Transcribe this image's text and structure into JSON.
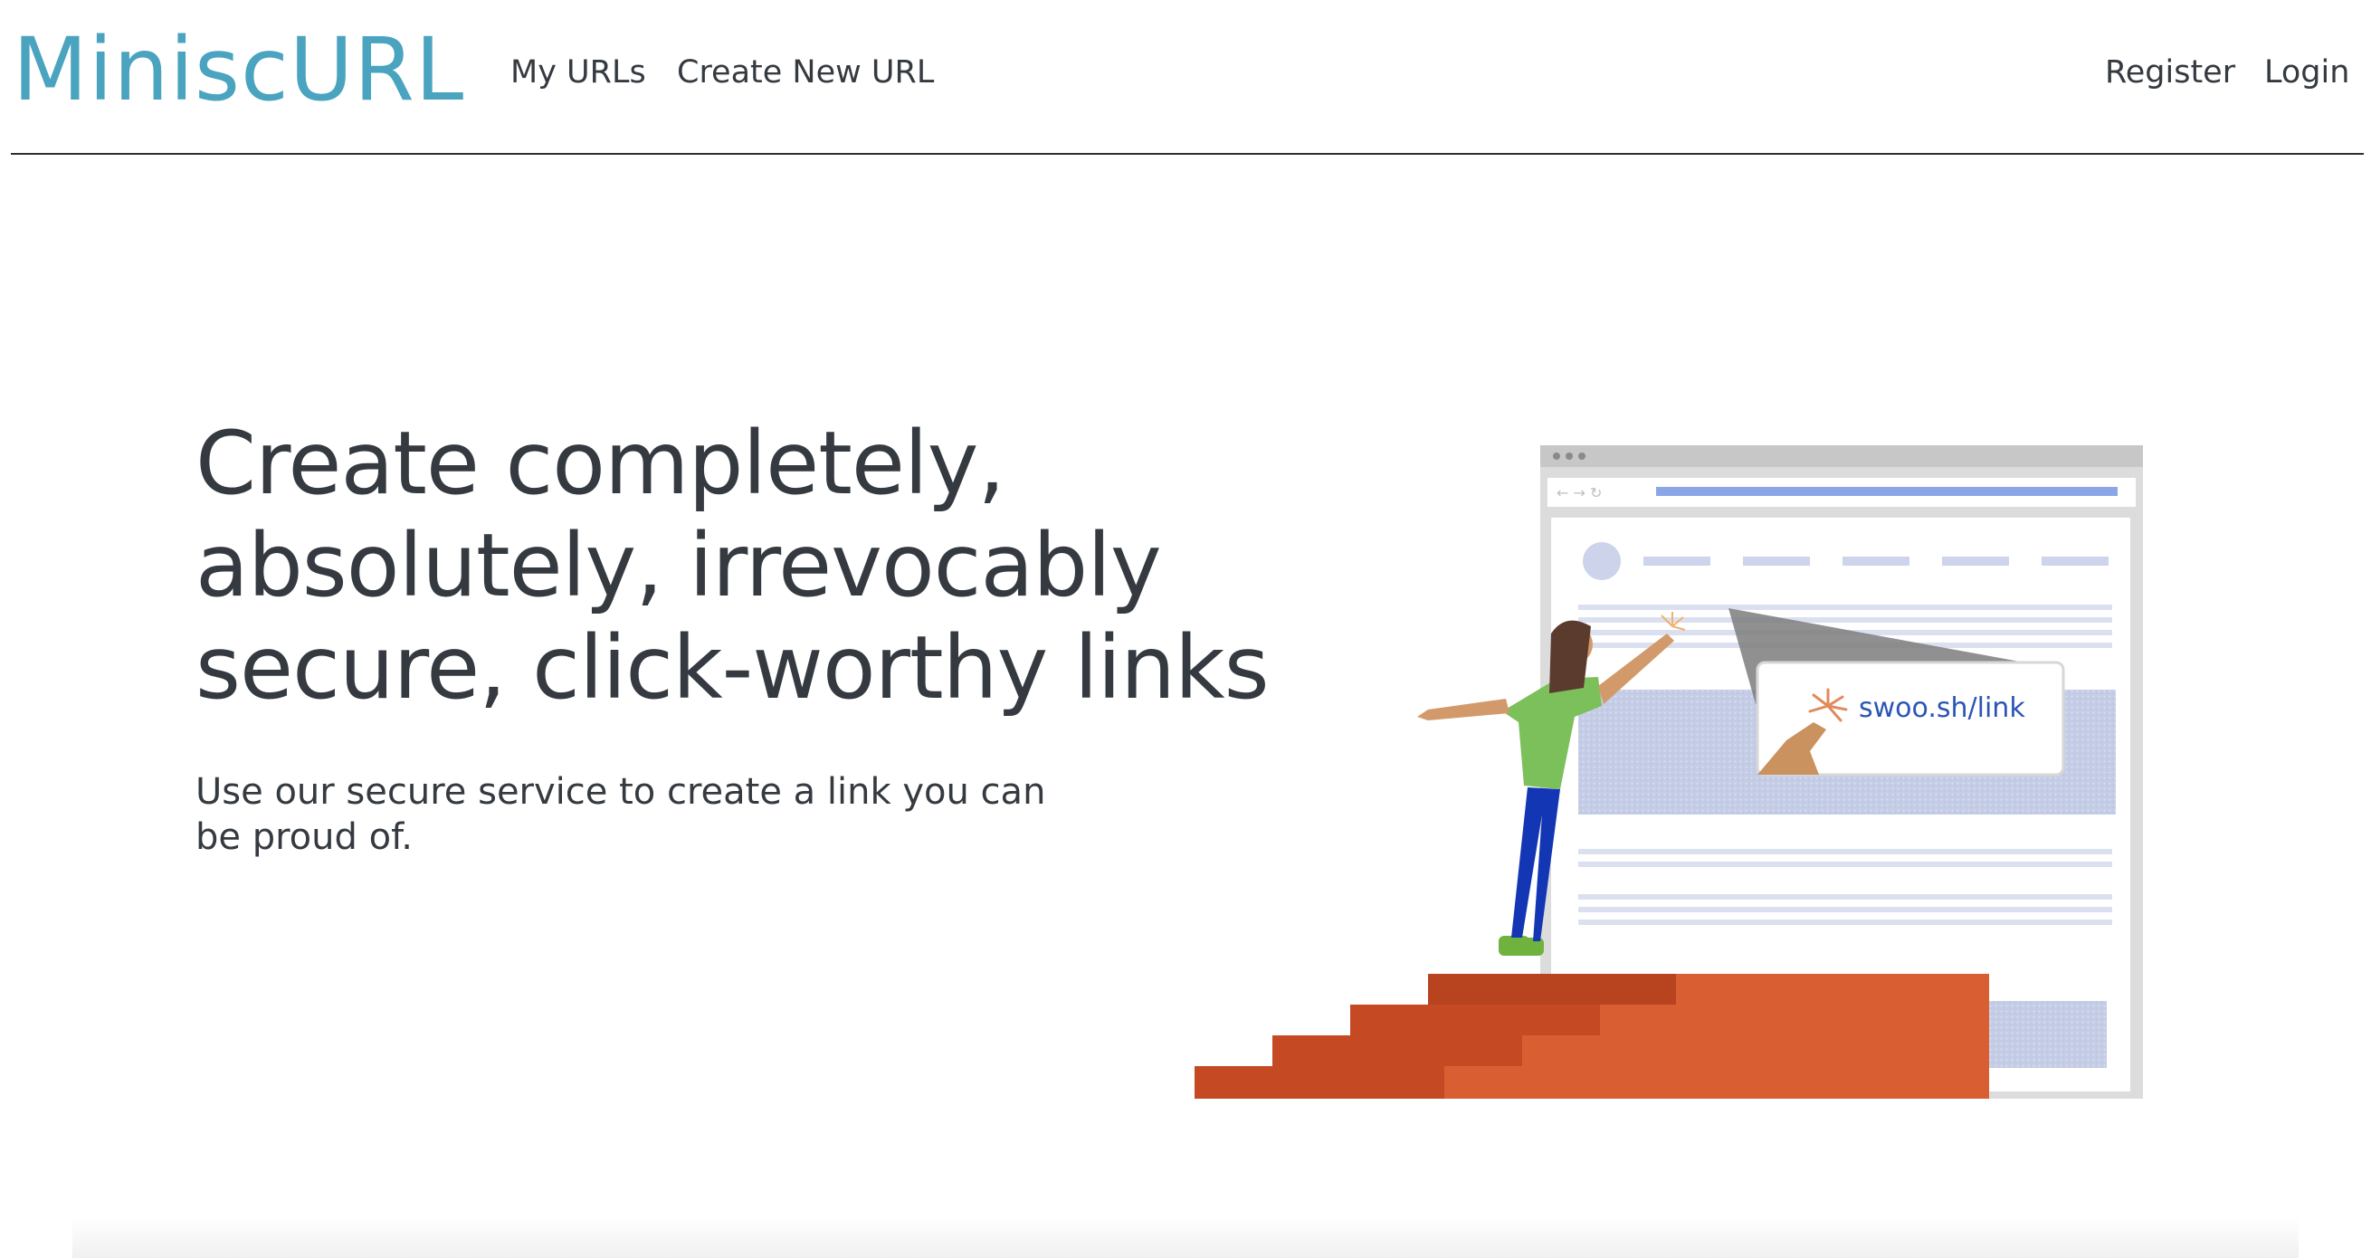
{
  "navbar": {
    "brand": "MiniscURL",
    "links": [
      {
        "label": "My URLs"
      },
      {
        "label": "Create New URL"
      }
    ],
    "auth": [
      {
        "label": "Register"
      },
      {
        "label": "Login"
      }
    ]
  },
  "hero": {
    "title": "Create completely, absolutely, irrevocably secure, click-worthy links",
    "subtitle": "Use our secure service to create a link you can be proud of.",
    "illustration": {
      "link_text": "swoo.sh/link"
    }
  },
  "colors": {
    "brand": "#4aa3bf",
    "text": "#343a40",
    "stairs": "#d95f33",
    "link": "#2b55b5"
  }
}
